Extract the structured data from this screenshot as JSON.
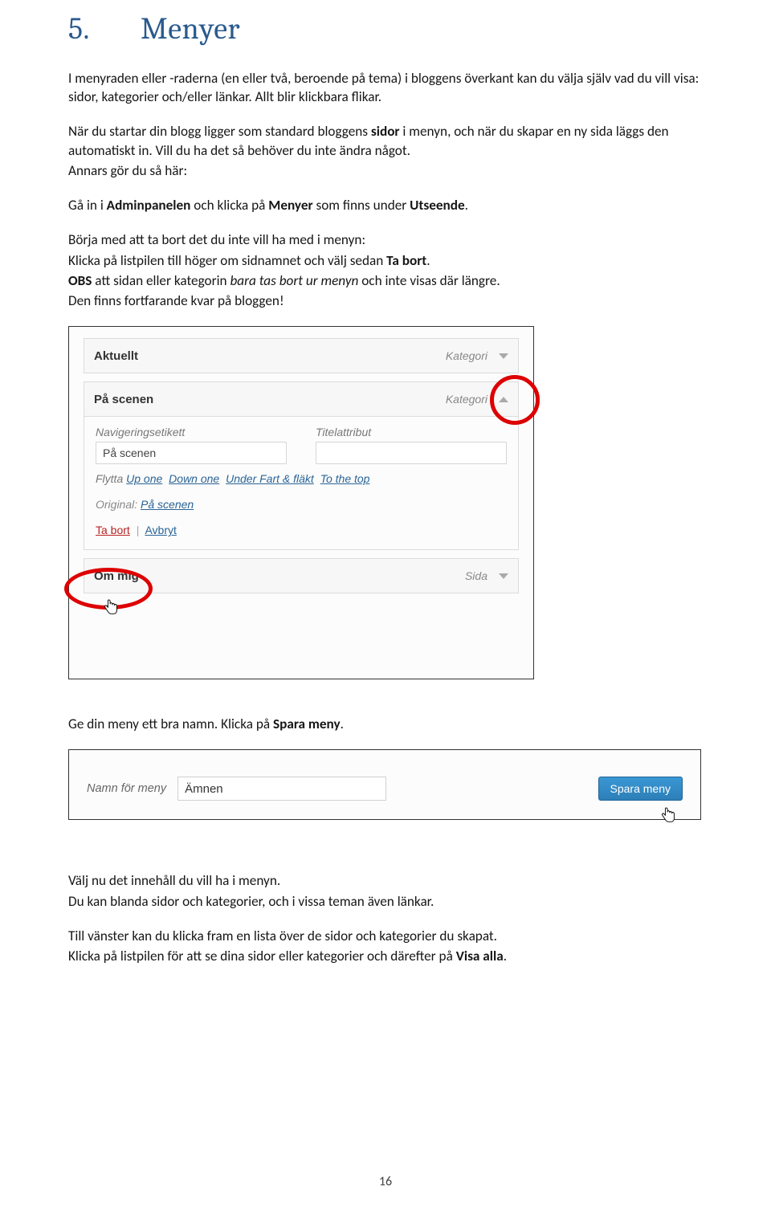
{
  "heading": {
    "number": "5.",
    "title": "Menyer"
  },
  "para1": "I menyraden eller -raderna (en eller två, beroende på tema) i bloggens överkant kan du välja själv vad du vill visa: sidor, kategorier och/eller länkar. Allt blir klickbara flikar.",
  "para2_pre": "När du startar din blogg ligger som standard bloggens ",
  "para2_b1": "sidor",
  "para2_mid": " i menyn, och när du skapar en ny sida läggs den automatiskt in. Vill du ha det så behöver du inte ändra något.",
  "para2b": "Annars gör du så här:",
  "para3_pre": "Gå in i ",
  "para3_b1": "Adminpanelen",
  "para3_mid": " och klicka på ",
  "para3_b2": "Menyer",
  "para3_mid2": " som finns under ",
  "para3_b3": "Utseende",
  "para3_post": ".",
  "para4a": "Börja med att ta bort det du inte vill ha med i menyn:",
  "para4b_pre": "Klicka på listpilen till höger om sidnamnet och välj sedan ",
  "para4b_b": "Ta bort",
  "para4b_post": ".",
  "para4c_pre1": "OBS",
  "para4c_mid1": " att sidan eller kategorin ",
  "para4c_i": "bara tas bort ur menyn",
  "para4c_mid2": " och inte visas där längre.",
  "para4d": "Den finns fortfarande kvar på bloggen!",
  "shot1": {
    "items": {
      "0": {
        "title": "Aktuellt",
        "type": "Kategori"
      },
      "1": {
        "title": "På scenen",
        "type": "Kategori"
      },
      "2": {
        "title": "Om mig",
        "type": "Sida"
      }
    },
    "fields": {
      "navlabel_label": "Navigeringsetikett",
      "navlabel_value": "På scenen",
      "titleattr_label": "Titelattribut",
      "titleattr_value": ""
    },
    "move": {
      "prefix": "Flytta",
      "l1": "Up one",
      "l2": "Down one",
      "l3": "Under Fart & fläkt",
      "l4": "To the top"
    },
    "original_prefix": "Original:",
    "original_link": "På scenen",
    "action_remove": "Ta bort",
    "action_cancel": "Avbryt"
  },
  "para5_pre": "Ge din meny ett bra namn. Klicka på ",
  "para5_b": "Spara meny",
  "para5_post": ".",
  "shot2": {
    "name_label": "Namn för meny",
    "name_value": "Ämnen",
    "save_button": "Spara meny"
  },
  "para6a": "Välj nu det innehåll du vill ha i menyn.",
  "para6b": "Du kan blanda sidor och kategorier, och i vissa teman även länkar.",
  "para7a": "Till vänster kan du klicka fram en lista över de sidor och kategorier du skapat.",
  "para7b_pre": "Klicka på listpilen för att se dina sidor eller kategorier och därefter på ",
  "para7b_b": "Visa alla",
  "para7b_post": ".",
  "page_number": "16"
}
